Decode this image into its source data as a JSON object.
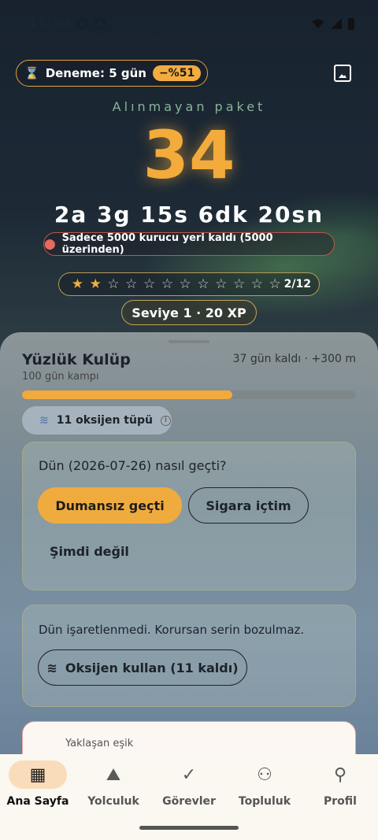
{
  "status_bar": {
    "time": "11:39"
  },
  "header": {
    "trial_label": "Deneme: 5 gün",
    "discount": "−%51",
    "subtitle": "Alınmayan paket",
    "count": "34",
    "countdown": "2a 3g 15s 6dk 20sn",
    "founder_notice": "Sadece 5000 kurucu yeri kaldı (5000 üzerinden)",
    "stars": {
      "filled": 2,
      "total": 12,
      "label": "2/12"
    },
    "level": "Seviye 1 · 20 XP"
  },
  "club": {
    "title": "Yüzlük Kulüp",
    "subtitle": "100 gün kampı",
    "meta": "37 gün kaldı · +300 m",
    "progress": 0.63,
    "oxygen_chip": "11 oksijen tüpü"
  },
  "checkin_card": {
    "question": "Dün (2026-07-26) nasıl geçti?",
    "primary": "Dumansız geçti",
    "secondary": "Sigara içtim",
    "tertiary": "Şimdi değil"
  },
  "streak_card": {
    "notice": "Dün işaretlenmedi. Korursan serin bozulmaz.",
    "button": "Oksijen kullan (11 kaldı)"
  },
  "threshold_card": {
    "label": "Yaklaşan eşik"
  },
  "nav": [
    {
      "label": "Ana Sayfa",
      "icon": "calendar-icon",
      "active": true
    },
    {
      "label": "Yolculuk",
      "icon": "mountain-icon",
      "active": false
    },
    {
      "label": "Görevler",
      "icon": "check-circle-icon",
      "active": false
    },
    {
      "label": "Topluluk",
      "icon": "group-icon",
      "active": false
    },
    {
      "label": "Profil",
      "icon": "person-icon",
      "active": false
    }
  ],
  "colors": {
    "accent": "#f3ad3e",
    "danger": "#c0544a"
  }
}
